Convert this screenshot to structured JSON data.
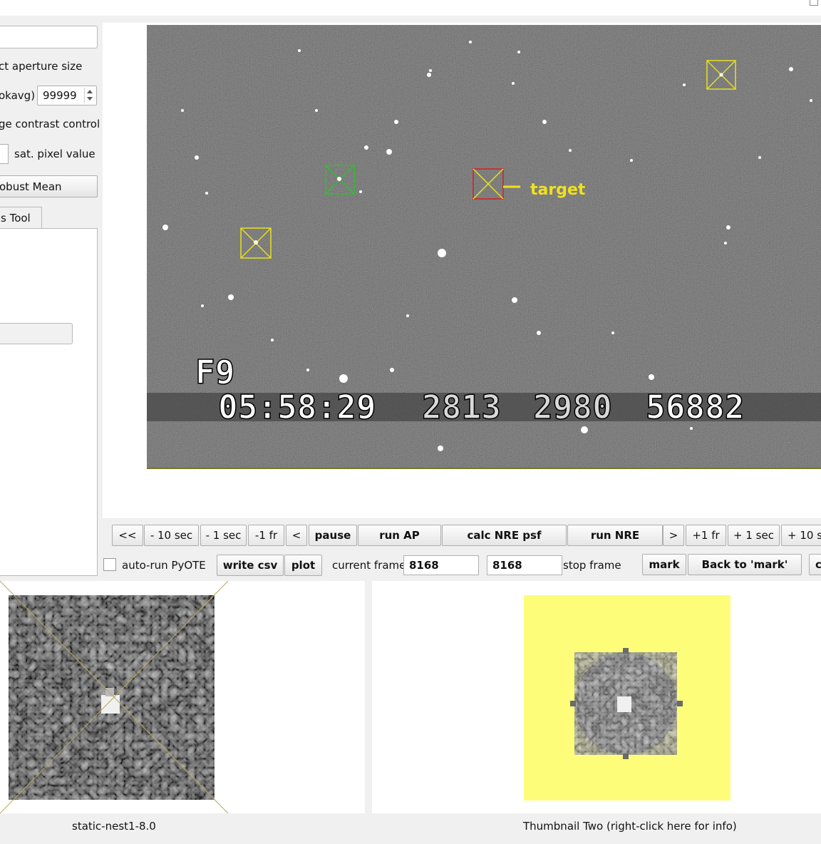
{
  "left_panel": {
    "aperture_label": "ct aperture size",
    "blockavg_label": "okavg)",
    "blockavg_value": "99999",
    "contrast_label": "ge contrast control",
    "sat_label": "sat. pixel value",
    "robust_button": "obust Mean",
    "tool_tab": "s Tool"
  },
  "video": {
    "target_label": "target",
    "overlay_line1": "F9",
    "overlay_time": "05:58:29",
    "overlay_num1": "2813",
    "overlay_num2": "2980",
    "overlay_num3": "56882",
    "colors": {
      "target_box": "#d62020",
      "ref_box_green": "#2fbf2f",
      "ref_box_yellow": "#e8e020",
      "target_text": "#f0e020"
    }
  },
  "controls_row1": [
    "<<",
    "- 10 sec",
    "- 1 sec",
    "-1 fr",
    "<",
    "pause",
    "run AP",
    "calc NRE psf",
    "run NRE",
    ">",
    "+1 fr",
    "+ 1 sec",
    "+ 10 s"
  ],
  "controls_row2": {
    "autorun_label": "auto-run PyOTE",
    "write_csv": "write csv",
    "plot": "plot",
    "current_frame_label": "current frame",
    "current_frame_value": "8168",
    "stop_frame_value": "8168",
    "stop_frame_label": "stop frame",
    "mark": "mark",
    "back_to_mark": "Back to 'mark'",
    "cut_button": "c"
  },
  "thumbnails": {
    "left_caption": "static-nest1-8.0",
    "right_caption": "Thumbnail Two (right-click here for info)",
    "right_bg": "#fdfd7a"
  }
}
